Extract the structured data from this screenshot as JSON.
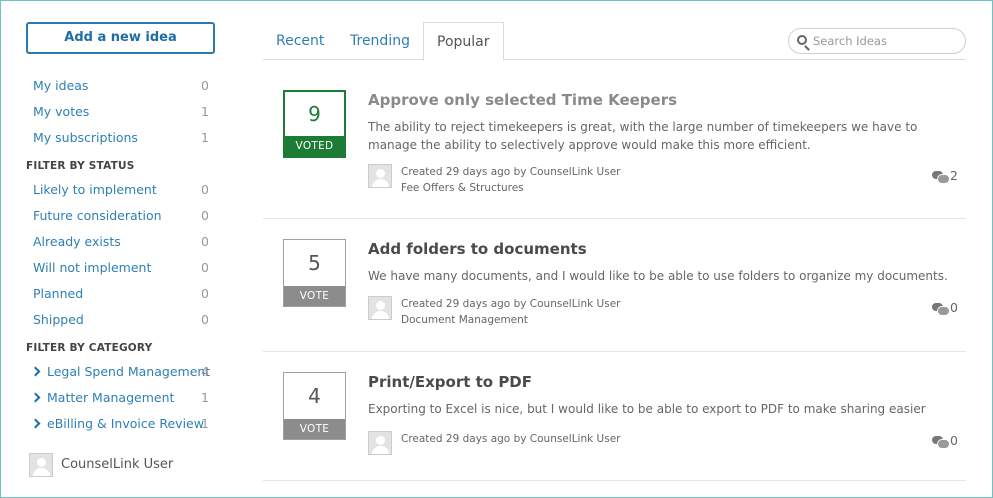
{
  "sidebar": {
    "add_button": "Add a new idea",
    "mine": [
      {
        "label": "My ideas",
        "count": "0"
      },
      {
        "label": "My votes",
        "count": "1"
      },
      {
        "label": "My subscriptions",
        "count": "1"
      }
    ],
    "status_heading": "FILTER BY STATUS",
    "status": [
      {
        "label": "Likely to implement",
        "count": "0"
      },
      {
        "label": "Future consideration",
        "count": "0"
      },
      {
        "label": "Already exists",
        "count": "0"
      },
      {
        "label": "Will not implement",
        "count": "0"
      },
      {
        "label": "Planned",
        "count": "0"
      },
      {
        "label": "Shipped",
        "count": "0"
      }
    ],
    "category_heading": "FILTER BY CATEGORY",
    "categories": [
      {
        "label": "Legal Spend Management",
        "count": "4"
      },
      {
        "label": "Matter Management",
        "count": "1"
      },
      {
        "label": "eBilling & Invoice Review",
        "count": "1"
      }
    ],
    "user_name": "CounselLink User"
  },
  "tabs": [
    {
      "label": "Recent",
      "active": false
    },
    {
      "label": "Trending",
      "active": false
    },
    {
      "label": "Popular",
      "active": true
    }
  ],
  "search": {
    "placeholder": "Search Ideas",
    "icon": "search-icon"
  },
  "ideas": [
    {
      "votes": "9",
      "vote_label": "VOTED",
      "voted": true,
      "title": "Approve only selected Time Keepers",
      "description": "The ability to reject timekeepers is great, with the large number of timekeepers we have to manage the ability to selectively approve would make this more efficient.",
      "created": "Created 29 days ago by CounselLink User",
      "category": "Fee Offers & Structures",
      "comments": "2"
    },
    {
      "votes": "5",
      "vote_label": "VOTE",
      "voted": false,
      "title": "Add folders to documents",
      "description": "We have many documents, and I would like to be able to use folders to organize my documents.",
      "created": "Created 29 days ago by CounselLink User",
      "category": "Document Management",
      "comments": "0"
    },
    {
      "votes": "4",
      "vote_label": "VOTE",
      "voted": false,
      "title": "Print/Export to PDF",
      "description": "Exporting to Excel is nice, but I would like to be able to export to PDF to make sharing easier",
      "created": "Created 29 days ago by CounselLink User",
      "category": "",
      "comments": "0"
    }
  ],
  "colors": {
    "link": "#2f7fb5",
    "voted": "#1c7b34",
    "vote_gray": "#8c8c8c",
    "frame": "#6ec3c0"
  }
}
